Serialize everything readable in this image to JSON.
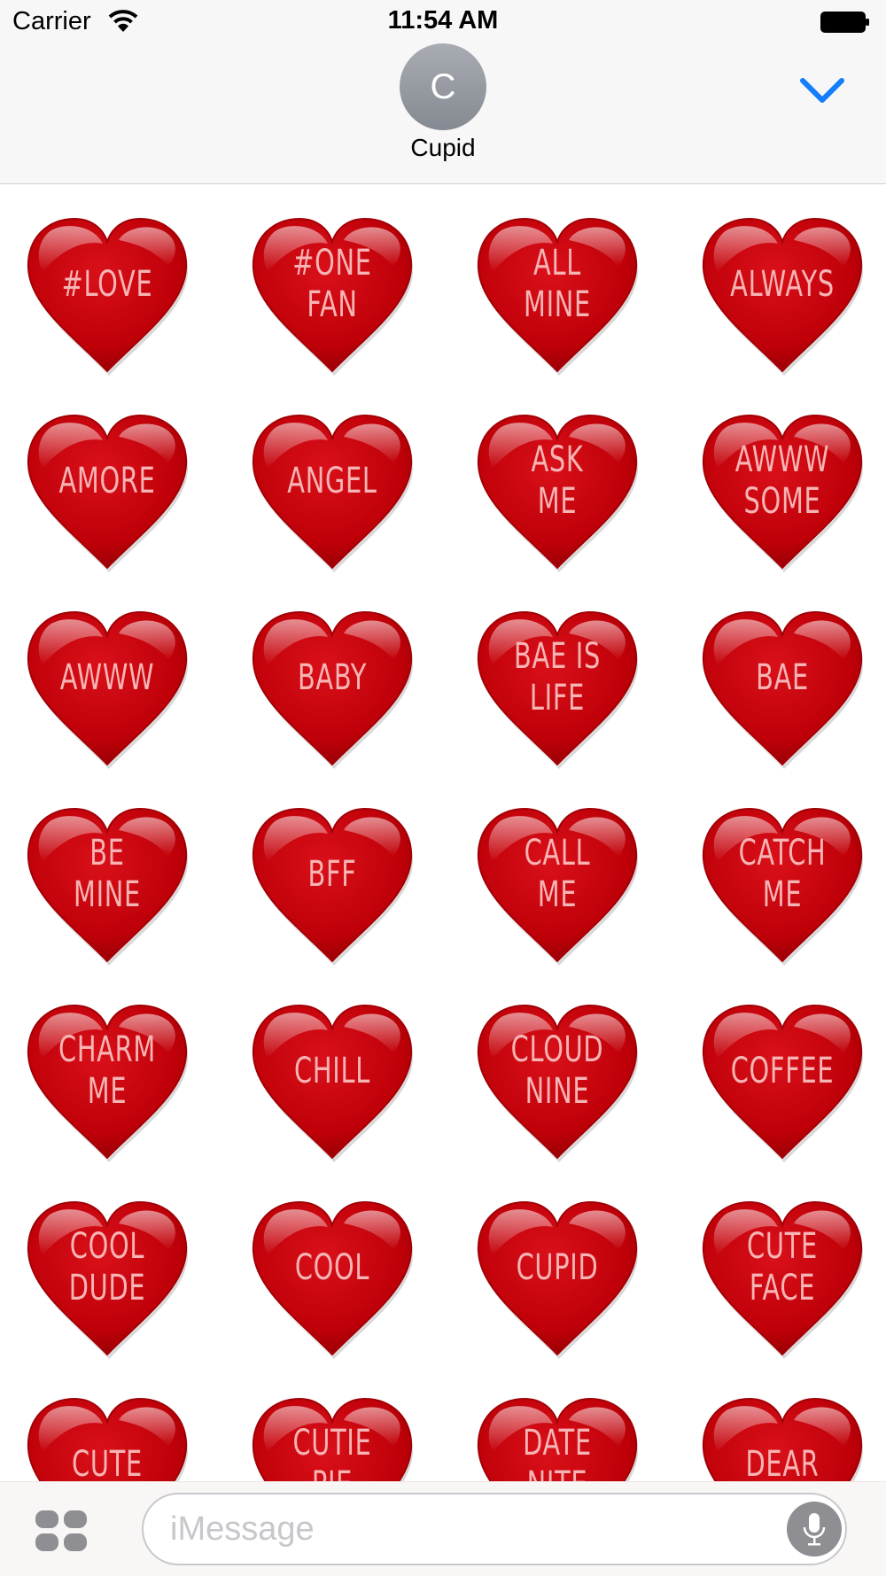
{
  "status_bar": {
    "carrier": "Carrier",
    "time": "11:54 AM"
  },
  "header": {
    "avatar_initial": "C",
    "contact_name": "Cupid"
  },
  "stickers": [
    [
      "#LOVE"
    ],
    [
      "#ONE",
      "FAN"
    ],
    [
      "ALL",
      "MINE"
    ],
    [
      "ALWAYS"
    ],
    [
      "AMORE"
    ],
    [
      "ANGEL"
    ],
    [
      "ASK",
      "ME"
    ],
    [
      "AWWW",
      "SOME"
    ],
    [
      "AWWW"
    ],
    [
      "BABY"
    ],
    [
      "BAE IS",
      "LIFE"
    ],
    [
      "BAE"
    ],
    [
      "BE",
      "MINE"
    ],
    [
      "BFF"
    ],
    [
      "CALL",
      "ME"
    ],
    [
      "CATCH",
      "ME"
    ],
    [
      "CHARM",
      "ME"
    ],
    [
      "CHILL"
    ],
    [
      "CLOUD",
      "NINE"
    ],
    [
      "COFFEE"
    ],
    [
      "COOL",
      "DUDE"
    ],
    [
      "COOL"
    ],
    [
      "CUPID"
    ],
    [
      "CUTE",
      "FACE"
    ],
    [
      "CUTE"
    ],
    [
      "CUTIE",
      "PIE"
    ],
    [
      "DATE",
      "NITE"
    ],
    [
      "DEAR"
    ]
  ],
  "composer": {
    "placeholder": "iMessage"
  },
  "icons": {
    "wifi": "wifi-icon",
    "battery": "battery-icon",
    "chevron": "chevron-down-icon",
    "apps": "app-drawer-icon",
    "mic": "microphone-icon"
  },
  "colors": {
    "accent": "#147efb",
    "heart": "#c50009",
    "heart_text": "#f7b4b4",
    "avatar": "#9a9da4"
  }
}
